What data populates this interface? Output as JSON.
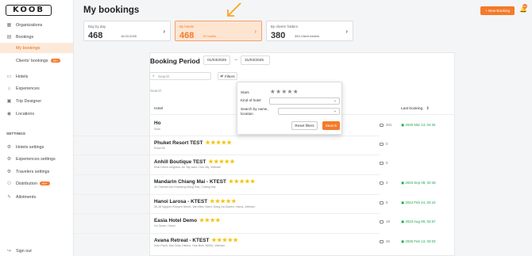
{
  "app": {
    "logo": "KOOB"
  },
  "sidebar": {
    "items": [
      {
        "label": "Organizations",
        "icon": "organizations-icon"
      },
      {
        "label": "Bookings",
        "icon": "bookings-icon"
      },
      {
        "label": "My bookings"
      },
      {
        "label": "Clients' bookings",
        "badge": "99+"
      },
      {
        "label": "Hotels",
        "icon": "hotel-icon"
      },
      {
        "label": "Experiences",
        "icon": "experiences-icon"
      },
      {
        "label": "Trip Designer",
        "icon": "trip-designer-icon"
      },
      {
        "label": "Locations",
        "icon": "location-pin-icon"
      }
    ],
    "settings_label": "SETTINGS",
    "settings_items": [
      {
        "label": "Hotels settings",
        "icon": "settings-icon"
      },
      {
        "label": "Experiences settings",
        "icon": "settings-icon"
      },
      {
        "label": "Travelers settings",
        "icon": "settings-icon"
      },
      {
        "label": "Distribution",
        "badge": "99+",
        "icon": "distribution-icon"
      },
      {
        "label": "Allotments",
        "icon": "allotments-icon"
      }
    ],
    "signout_label": "Sign out"
  },
  "header": {
    "title": "My bookings",
    "new_booking_label": "+ New Booking",
    "bell_badge": "99+"
  },
  "stats": [
    {
      "label": "Day by day",
      "value": "468",
      "sub": "16.03.2025"
    },
    {
      "label": "By hotels",
      "value": "468",
      "sub": "92 hotels"
    },
    {
      "label": "By clients' folders",
      "value": "380",
      "sub": "353 Client folders"
    }
  ],
  "booking_period": {
    "title": "Booking Period",
    "from": "01/03/2025",
    "to": "31/03/2025"
  },
  "search": {
    "placeholder": "Search",
    "filters_label": "Filters",
    "results_label": "Search"
  },
  "filter_popup": {
    "stars_label": "Stars",
    "kind_label": "Kind of hotel",
    "search_label_1": "Search by name,",
    "search_label_2": "location",
    "reset_label": "Reset filters",
    "search_label": "Search"
  },
  "table": {
    "headers": {
      "hotel": "Hotel",
      "last_booking": "Last booking"
    },
    "rows": [
      {
        "name": "Ho",
        "address": "Sukh",
        "stars": "★★★★★",
        "count": "201",
        "last": "2025 Mar 13, 04:34"
      },
      {
        "name": "Phuket Resort TEST",
        "address": "Road 66",
        "stars": "★★★★★",
        "count": "0",
        "last": ""
      },
      {
        "name": "Anhill Boutique TEST",
        "address": "Khai Dinh's neighbor, An Tay ward, Hue city, Vietnam",
        "stars": "★★★★★",
        "count": "0",
        "last": ""
      },
      {
        "name": "Mandarin Chiang Mai - KTEST",
        "address": "40 Oriental Ave Khwaeng Bang Rak, Chiang Mai",
        "stars": "★★★★★",
        "count": "4",
        "last": "2023 Sep 08, 02:45"
      },
      {
        "name": "Hanoi Larosa - KTEST",
        "address": "36-38 Nguyen Khuyen Street, Van Mieu Ward, Dong Da District, Hanoi, Vietnam",
        "stars": "★★★★★",
        "count": "5",
        "last": "2024 Feb 24, 04:10"
      },
      {
        "name": "Easia Hotel Demo",
        "address": "Ho Guom, Hanoi",
        "stars": "★★★★",
        "count": "19",
        "last": "2023 Aug 09, 02:57"
      },
      {
        "name": "Avana Retreat - KTEST",
        "address": "Xóm Pạnh, Mai Châu District, Hòa Bình 36000, Vietnam",
        "stars": "★★★★★",
        "count": "25",
        "last": "2025 Feb 13, 03:03"
      }
    ]
  },
  "colors": {
    "accent": "#f47a2a",
    "highlight_bg": "#fde5d2",
    "star": "#f2c200",
    "date_green": "#1aa64b"
  }
}
